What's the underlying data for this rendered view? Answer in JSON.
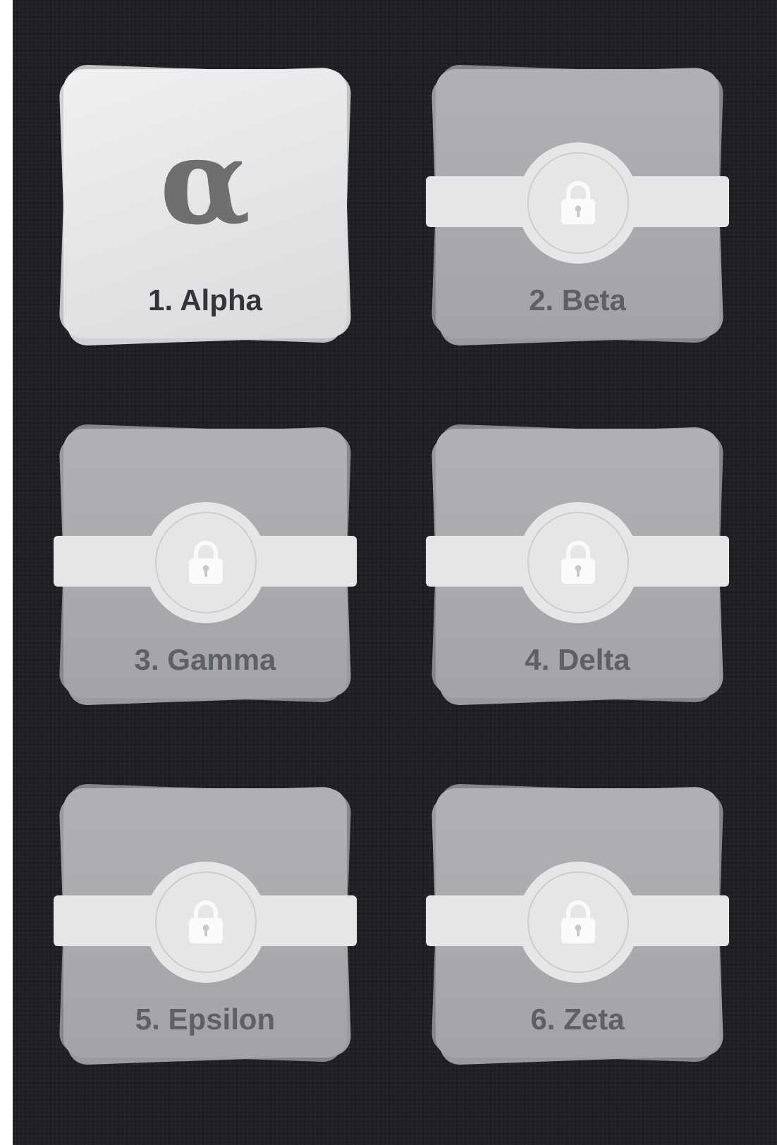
{
  "levels": [
    {
      "label": "1. Alpha",
      "symbol": "α",
      "locked": false
    },
    {
      "label": "2. Beta",
      "locked": true
    },
    {
      "label": "3. Gamma",
      "locked": true
    },
    {
      "label": "4. Delta",
      "locked": true
    },
    {
      "label": "5. Epsilon",
      "locked": true
    },
    {
      "label": "6. Zeta",
      "locked": true
    }
  ]
}
